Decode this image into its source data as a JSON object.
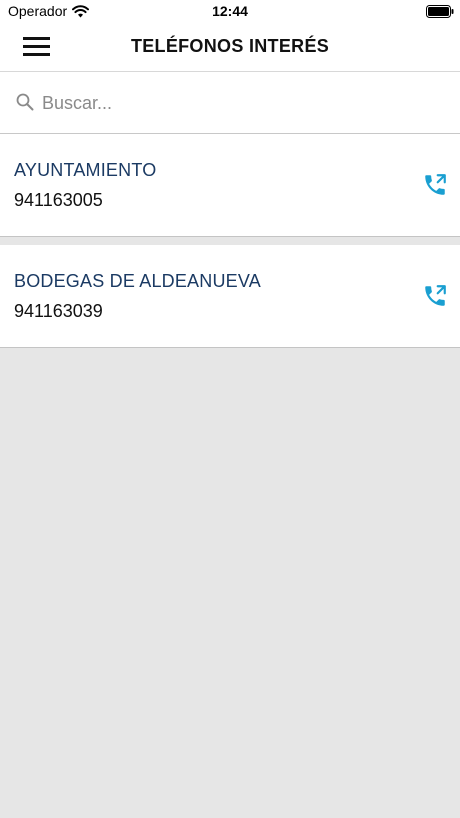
{
  "status_bar": {
    "carrier": "Operador",
    "time": "12:44",
    "wifi_icon": "wifi-icon",
    "battery_icon": "battery-full-icon"
  },
  "header": {
    "title": "TELÉFONOS INTERÉS",
    "menu_icon": "hamburger-menu-icon"
  },
  "search": {
    "placeholder": "Buscar...",
    "value": "",
    "icon": "search-icon"
  },
  "contacts": [
    {
      "name": "AYUNTAMIENTO",
      "phone": "941163005",
      "icon": "phone-call-icon"
    },
    {
      "name": "BODEGAS DE ALDEANUEVA",
      "phone": "941163039",
      "icon": "phone-call-icon"
    }
  ],
  "colors": {
    "accent": "#1a9fd1",
    "name_text": "#1b3a63",
    "background": "#e6e6e6"
  }
}
